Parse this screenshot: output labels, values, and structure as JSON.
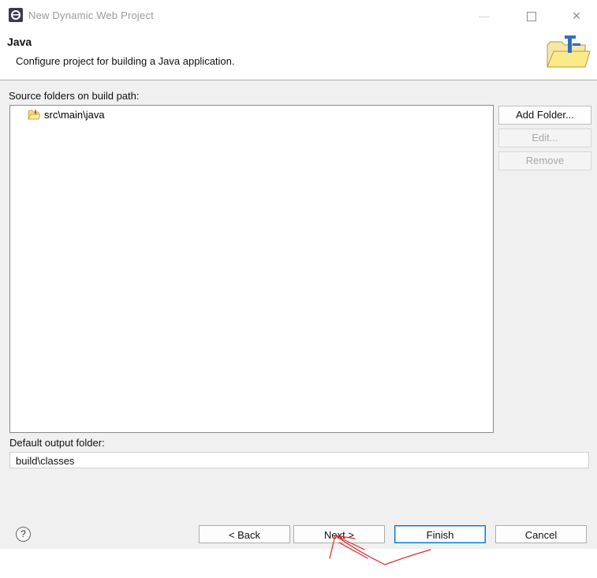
{
  "window": {
    "title": "New Dynamic Web Project",
    "minimize_glyph": "—",
    "close_glyph": "✕"
  },
  "header": {
    "title": "Java",
    "description": "Configure project for building a Java application."
  },
  "source_folders": {
    "label": "Source folders on build path:",
    "items": [
      "src\\main\\java"
    ]
  },
  "side_buttons": {
    "add_folder": "Add Folder...",
    "edit": "Edit...",
    "remove": "Remove"
  },
  "output": {
    "label": "Default output folder:",
    "value": "build\\classes"
  },
  "footer": {
    "help_glyph": "?",
    "back": "< Back",
    "next": "Next >",
    "finish": "Finish",
    "cancel": "Cancel"
  },
  "colors": {
    "annotation": "#e2262a",
    "default_button_border": "#0078d7",
    "dialog_background": "#f0f0f0"
  }
}
